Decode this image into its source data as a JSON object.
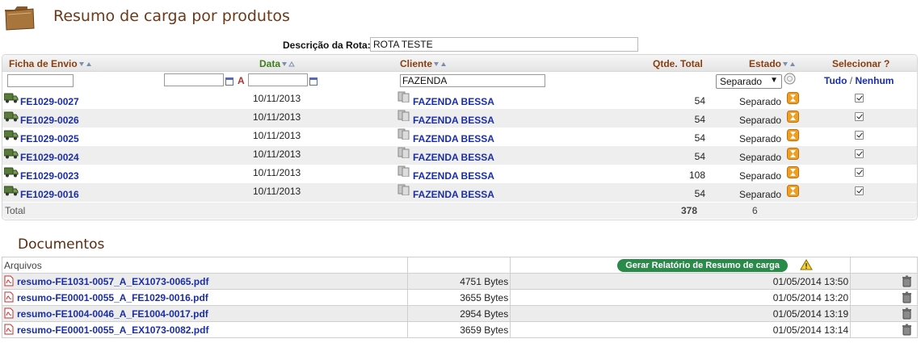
{
  "page": {
    "title": "Resumo de carga por produtos"
  },
  "rota": {
    "label": "Descrição da Rota:",
    "value": "ROTA TESTE"
  },
  "grid": {
    "headers": {
      "ficha": "Ficha de Envio",
      "data": "Data",
      "cliente": "Cliente",
      "qtde": "Qtde. Total",
      "estado": "Estado",
      "selecionar": "Selecionar ?"
    },
    "filters": {
      "ficha": "",
      "data_from": "",
      "a_label": "A",
      "data_to": "",
      "cliente": "FAZENDA",
      "estado": "Separado",
      "tudo": "Tudo",
      "separator": "/",
      "nenhum": "Nenhum"
    },
    "rows": [
      {
        "ficha": "FE1029-0027",
        "data": "10/11/2013",
        "cliente": "FAZENDA BESSA",
        "qtde": "54",
        "estado": "Separado",
        "checked": true
      },
      {
        "ficha": "FE1029-0026",
        "data": "10/11/2013",
        "cliente": "FAZENDA BESSA",
        "qtde": "54",
        "estado": "Separado",
        "checked": true
      },
      {
        "ficha": "FE1029-0025",
        "data": "10/11/2013",
        "cliente": "FAZENDA BESSA",
        "qtde": "54",
        "estado": "Separado",
        "checked": true
      },
      {
        "ficha": "FE1029-0024",
        "data": "10/11/2013",
        "cliente": "FAZENDA BESSA",
        "qtde": "54",
        "estado": "Separado",
        "checked": true
      },
      {
        "ficha": "FE1029-0023",
        "data": "10/11/2013",
        "cliente": "FAZENDA BESSA",
        "qtde": "108",
        "estado": "Separado",
        "checked": true
      },
      {
        "ficha": "FE1029-0016",
        "data": "10/11/2013",
        "cliente": "FAZENDA BESSA",
        "qtde": "54",
        "estado": "Separado",
        "checked": true
      }
    ],
    "total": {
      "label": "Total",
      "qtde": "378",
      "count": "6"
    }
  },
  "documents": {
    "title": "Documentos",
    "header": {
      "arquivos": "Arquivos",
      "button": "Gerar Relatório de Resumo de carga"
    },
    "rows": [
      {
        "file": "resumo-FE1031-0057_A_EX1073-0065.pdf",
        "size": "4751 Bytes",
        "date": "01/05/2014 13:50"
      },
      {
        "file": "resumo-FE0001-0055_A_FE1029-0016.pdf",
        "size": "3655 Bytes",
        "date": "01/05/2014 13:20"
      },
      {
        "file": "resumo-FE1004-0046_A_FE1004-0017.pdf",
        "size": "2954 Bytes",
        "date": "01/05/2014 13:19"
      },
      {
        "file": "resumo-FE0001-0055_A_EX1073-0082.pdf",
        "size": "3659 Bytes",
        "date": "01/05/2014 13:14"
      }
    ]
  },
  "colors": {
    "title": "#6b3a1a",
    "header_text": "#8a3e0f",
    "link": "#1a2ea8",
    "button": "#2a8a4a",
    "hourglass": "#f0a020"
  }
}
